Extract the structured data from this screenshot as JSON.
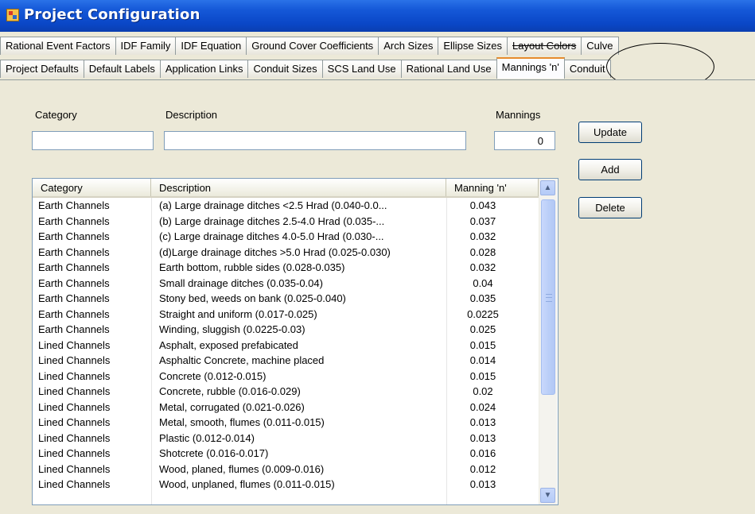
{
  "window": {
    "title": "Project Configuration"
  },
  "tabs_row1": [
    "Rational Event Factors",
    "IDF Family",
    "IDF Equation",
    "Ground Cover Coefficients",
    "Arch Sizes",
    "Ellipse Sizes",
    "Layout Colors",
    "Culve"
  ],
  "tabs_row2": [
    "Project Defaults",
    "Default Labels",
    "Application Links",
    "Conduit Sizes",
    "SCS Land Use",
    "Rational Land Use",
    "Mannings 'n'",
    "Conduit"
  ],
  "selected_tab": "Mannings 'n'",
  "form": {
    "category_label": "Category",
    "category_value": "",
    "description_label": "Description",
    "description_value": "",
    "mannings_label": "Mannings",
    "mannings_value": "0"
  },
  "buttons": {
    "update": "Update",
    "add": "Add",
    "delete": "Delete"
  },
  "grid": {
    "columns": [
      "Category",
      "Description",
      "Manning 'n'"
    ],
    "rows": [
      [
        "Earth Channels",
        "(a) Large drainage ditches <2.5 Hrad (0.040-0.0...",
        "0.043"
      ],
      [
        "Earth Channels",
        "(b) Large drainage ditches 2.5-4.0  Hrad (0.035-...",
        "0.037"
      ],
      [
        "Earth Channels",
        "(c) Large drainage ditches 4.0-5.0  Hrad (0.030-...",
        "0.032"
      ],
      [
        "Earth Channels",
        "(d)Large drainage ditches >5.0 Hrad (0.025-0.030)",
        "0.028"
      ],
      [
        "Earth Channels",
        "Earth bottom, rubble sides (0.028-0.035)",
        "0.032"
      ],
      [
        "Earth Channels",
        "Small drainage ditches (0.035-0.04)",
        "0.04"
      ],
      [
        "Earth Channels",
        "Stony bed, weeds on bank (0.025-0.040)",
        "0.035"
      ],
      [
        "Earth Channels",
        "Straight and uniform (0.017-0.025)",
        "0.0225"
      ],
      [
        "Earth Channels",
        "Winding, sluggish (0.0225-0.03)",
        "0.025"
      ],
      [
        "Lined Channels",
        "Asphalt, exposed prefabicated",
        "0.015"
      ],
      [
        "Lined Channels",
        "Asphaltic Concrete, machine placed",
        "0.014"
      ],
      [
        "Lined Channels",
        "Concrete (0.012-0.015)",
        "0.015"
      ],
      [
        "Lined Channels",
        "Concrete, rubble (0.016-0.029)",
        "0.02"
      ],
      [
        "Lined Channels",
        "Metal, corrugated (0.021-0.026)",
        "0.024"
      ],
      [
        "Lined Channels",
        "Metal, smooth, flumes (0.011-0.015)",
        "0.013"
      ],
      [
        "Lined Channels",
        "Plastic (0.012-0.014)",
        "0.013"
      ],
      [
        "Lined Channels",
        "Shotcrete (0.016-0.017)",
        "0.016"
      ],
      [
        "Lined Channels",
        "Wood, planed, flumes (0.009-0.016)",
        "0.012"
      ],
      [
        "Lined Channels",
        "Wood, unplaned, flumes (0.011-0.015)",
        "0.013"
      ]
    ]
  },
  "icons": {
    "app": "app-icon",
    "scroll_up": "scroll-up-arrow-icon",
    "scroll_down": "scroll-down-arrow-icon",
    "grip": "scroll-grip-icon"
  },
  "colors": {
    "titlebar": "#0a47c7",
    "selected_tab_accent": "#e68b2c",
    "scrollbar": "#b5cbf7",
    "dialog_bg": "#ece9d8"
  }
}
